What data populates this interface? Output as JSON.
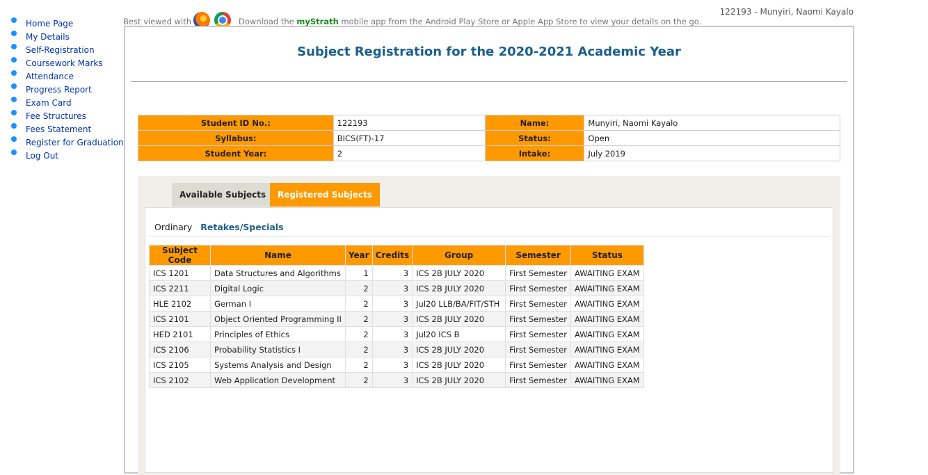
{
  "nav": {
    "items": [
      {
        "label": "Home Page"
      },
      {
        "label": "My Details"
      },
      {
        "label": "Self-Registration"
      },
      {
        "label": "Coursework Marks"
      },
      {
        "label": "Attendance"
      },
      {
        "label": "Progress Report"
      },
      {
        "label": "Exam Card"
      },
      {
        "label": "Fee Structures"
      },
      {
        "label": "Fees Statement"
      },
      {
        "label": "Register for Graduation"
      },
      {
        "label": "Log Out"
      }
    ]
  },
  "header": {
    "user": "122193 - Munyiri, Naomi Kayalo",
    "best_viewed": "Best viewed with",
    "download_pre": "Download the",
    "app_name": "myStrath",
    "download_post": "mobile app from the Android Play Store or Apple App Store to view your details on the go."
  },
  "page": {
    "title": "Subject Registration for the 2020-2021 Academic Year"
  },
  "student": {
    "id_label": "Student ID No.:",
    "id_value": "122193",
    "name_label": "Name:",
    "name_value": "Munyiri, Naomi Kayalo",
    "syllabus_label": "Syllabus:",
    "syllabus_value": "BICS(FT)-17",
    "status_label": "Status:",
    "status_value": "Open",
    "year_label": "Student Year:",
    "year_value": "2",
    "intake_label": "Intake:",
    "intake_value": "July 2019"
  },
  "tabs": {
    "available": "Available Subjects",
    "registered": "Registered Subjects"
  },
  "subtabs": {
    "ordinary": "Ordinary",
    "retakes": "Retakes/Specials"
  },
  "table": {
    "headers": [
      "Subject Code",
      "Name",
      "Year",
      "Credits",
      "Group",
      "Semester",
      "Status"
    ],
    "rows": [
      {
        "code": "ICS 1201",
        "name": "Data Structures and Algorithms",
        "year": "1",
        "credits": "3",
        "group": "ICS 2B JULY 2020",
        "semester": "First Semester",
        "status": "AWAITING EXAM"
      },
      {
        "code": "ICS 2211",
        "name": "Digital Logic",
        "year": "2",
        "credits": "3",
        "group": "ICS 2B JULY 2020",
        "semester": "First Semester",
        "status": "AWAITING EXAM"
      },
      {
        "code": "HLE 2102",
        "name": "German I",
        "year": "2",
        "credits": "3",
        "group": "Jul20 LLB/BA/FIT/STH",
        "semester": "First Semester",
        "status": "AWAITING EXAM"
      },
      {
        "code": "ICS 2101",
        "name": "Object Oriented Programming II",
        "year": "2",
        "credits": "3",
        "group": "ICS 2B JULY 2020",
        "semester": "First Semester",
        "status": "AWAITING EXAM"
      },
      {
        "code": "HED 2101",
        "name": "Principles of Ethics",
        "year": "2",
        "credits": "3",
        "group": "Jul20 ICS B",
        "semester": "First Semester",
        "status": "AWAITING EXAM"
      },
      {
        "code": "ICS 2106",
        "name": "Probability Statistics I",
        "year": "2",
        "credits": "3",
        "group": "ICS 2B JULY 2020",
        "semester": "First Semester",
        "status": "AWAITING EXAM"
      },
      {
        "code": "ICS 2105",
        "name": "Systems Analysis and Design",
        "year": "2",
        "credits": "3",
        "group": "ICS 2B JULY 2020",
        "semester": "First Semester",
        "status": "AWAITING EXAM"
      },
      {
        "code": "ICS 2102",
        "name": "Web Application Development",
        "year": "2",
        "credits": "3",
        "group": "ICS 2B JULY 2020",
        "semester": "First Semester",
        "status": "AWAITING EXAM"
      }
    ]
  },
  "colors": {
    "accent": "#ff9900",
    "title": "#1a5f8c",
    "link": "#0033aa",
    "bullet": "#1e90ff"
  },
  "icons": {
    "browser1": "firefox-icon",
    "browser2": "chrome-icon"
  }
}
